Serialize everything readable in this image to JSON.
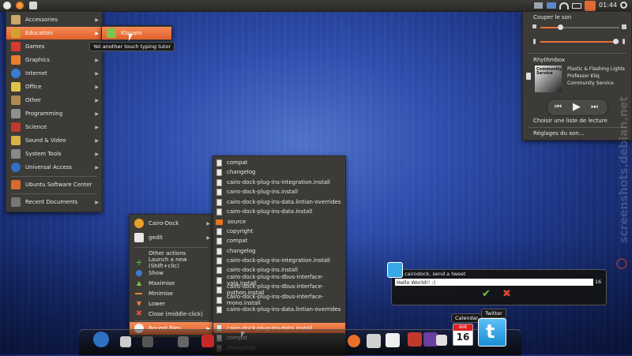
{
  "top_panel": {
    "clock": "01:44",
    "indicators": [
      "mail-icon",
      "network-icon",
      "battery-icon",
      "volume-icon",
      "power-icon"
    ]
  },
  "app_menu": {
    "items": [
      {
        "label": "Accessories",
        "icon": "accessories-icon",
        "color": "#c9a86a",
        "arrow": true
      },
      {
        "label": "Education",
        "icon": "education-icon",
        "color": "#d4a02e",
        "arrow": true,
        "highlight": true
      },
      {
        "label": "Games",
        "icon": "games-icon",
        "color": "#d63a2f",
        "arrow": true
      },
      {
        "label": "Graphics",
        "icon": "graphics-icon",
        "color": "#e87f2c",
        "arrow": true
      },
      {
        "label": "Internet",
        "icon": "internet-icon",
        "color": "#3a7bd5",
        "arrow": true
      },
      {
        "label": "Office",
        "icon": "office-icon",
        "color": "#e0c34a",
        "arrow": true
      },
      {
        "label": "Other",
        "icon": "other-icon",
        "color": "#b08a4c",
        "arrow": true
      },
      {
        "label": "Programming",
        "icon": "programming-icon",
        "color": "#8f8f8f",
        "arrow": true
      },
      {
        "label": "Science",
        "icon": "science-icon",
        "color": "#c0392b",
        "arrow": true
      },
      {
        "label": "Sound & Video",
        "icon": "sound-video-icon",
        "color": "#d8b243",
        "arrow": true
      },
      {
        "label": "System Tools",
        "icon": "system-tools-icon",
        "color": "#888888",
        "arrow": true
      },
      {
        "label": "Universal Access",
        "icon": "universal-access-icon",
        "color": "#2f6fc4",
        "arrow": true
      },
      {
        "label": "Ubuntu Software Center",
        "icon": "software-center-icon",
        "color": "#d96a2b",
        "arrow": false
      },
      {
        "label": "Recent Documents",
        "icon": "recent-documents-icon",
        "color": "#777777",
        "arrow": true
      }
    ],
    "submenu_item": "Klavaro",
    "tooltip": "Yet another touch typing tutor"
  },
  "sound_menu": {
    "mute_label": "Couper le son",
    "volume_level": 0.25,
    "mic_level": 0.95,
    "player_name": "Rhythmbox",
    "album_art_text": "Community Service",
    "track": "Plastic & Flashing Lights",
    "artist": "Professor Kliq",
    "album": "Community Service",
    "playlist_label": "Choisir une liste de lecture",
    "settings_label": "Réglages du son..."
  },
  "dock_menu": {
    "items": [
      {
        "label": "Cairo-Dock",
        "icon": "cairo-dock-icon",
        "arrow": true
      },
      {
        "label": "gedit",
        "icon": "gedit-icon",
        "arrow": true
      }
    ],
    "actions": [
      {
        "label": "Other actions",
        "icon": ""
      },
      {
        "label": "Launch a new (Shift+clic)",
        "icon": "plus-icon"
      },
      {
        "label": "Show",
        "icon": "show-icon"
      },
      {
        "label": "Maximise",
        "icon": "maximise-icon"
      },
      {
        "label": "Minimise",
        "icon": "minimise-icon"
      },
      {
        "label": "Lower",
        "icon": "lower-icon"
      },
      {
        "label": "Close (middle-click)",
        "icon": "close-icon"
      }
    ],
    "recent_files_label": "Recent files"
  },
  "files_menu": {
    "items": [
      {
        "label": "compat",
        "type": "file"
      },
      {
        "label": "changelog",
        "type": "file"
      },
      {
        "label": "cairo-dock-plug-ins-integration.install",
        "type": "file"
      },
      {
        "label": "cairo-dock-plug-ins.install",
        "type": "file"
      },
      {
        "label": "cairo-dock-plug-ins-data.lintian-overrides",
        "type": "file"
      },
      {
        "label": "cairo-dock-plug-ins-data.install",
        "type": "file"
      },
      {
        "label": "source",
        "type": "folder"
      },
      {
        "label": "copyright",
        "type": "file"
      },
      {
        "label": "compat",
        "type": "file"
      },
      {
        "label": "changelog",
        "type": "file"
      },
      {
        "label": "cairo-dock-plug-ins-integration.install",
        "type": "file"
      },
      {
        "label": "cairo-dock-plug-ins.install",
        "type": "file"
      },
      {
        "label": "cairo-dock-plug-ins-dbus-interface-vala.install",
        "type": "file"
      },
      {
        "label": "cairo-dock-plug-ins-dbus-interface-python.install",
        "type": "file"
      },
      {
        "label": "cairo-dock-plug-ins-dbus-interface-mono.install",
        "type": "file"
      },
      {
        "label": "cairo-dock-plug-ins-data.lintian-overrides",
        "type": "file"
      },
      {
        "label": "cairo-dock-plug-ins-data.install",
        "type": "file",
        "highlight": true
      },
      {
        "label": "compat",
        "type": "file"
      },
      {
        "label": "changelog",
        "type": "file"
      }
    ]
  },
  "tweet_dialog": {
    "title": "cairodock, send a tweet",
    "value": "Hello World!! :)",
    "counter": "16"
  },
  "dock": {
    "calendar_label": "Calendar",
    "calendar_day": "16",
    "calendar_month": "AVR",
    "twitter_label": "Twitter"
  },
  "watermark": "screenshots.debian.net"
}
